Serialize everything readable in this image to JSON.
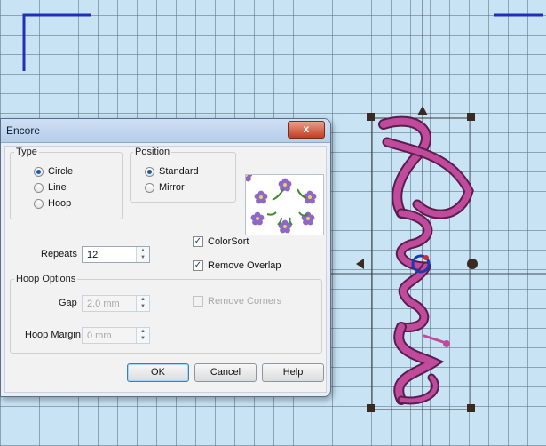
{
  "dialog": {
    "title": "Encore",
    "close_label": "x",
    "type_group": {
      "label": "Type",
      "options": [
        {
          "label": "Circle",
          "selected": true
        },
        {
          "label": "Line",
          "selected": false
        },
        {
          "label": "Hoop",
          "selected": false
        }
      ]
    },
    "position_group": {
      "label": "Position",
      "options": [
        {
          "label": "Standard",
          "selected": true
        },
        {
          "label": "Mirror",
          "selected": false
        }
      ]
    },
    "repeats": {
      "label": "Repeats",
      "value": "12"
    },
    "colorsort": {
      "label": "ColorSort",
      "checked": true
    },
    "remove_overlap": {
      "label": "Remove Overlap",
      "checked": true
    },
    "hoop_options": {
      "label": "Hoop Options",
      "gap": {
        "label": "Gap",
        "value": "2.0 mm"
      },
      "hoop_margin": {
        "label": "Hoop Margin",
        "value": "0 mm"
      },
      "remove_corners": {
        "label": "Remove Corners",
        "checked": false
      }
    },
    "buttons": {
      "ok": "OK",
      "cancel": "Cancel",
      "help": "Help"
    }
  },
  "colors": {
    "grid_bg": "#c8e4f4",
    "hoop_marker": "#1f2fb8",
    "stitch": "#c04a9b",
    "stitch_dark": "#5a1d4c",
    "flower_petal": "#8d67c9",
    "flower_leaf": "#3d8c2e"
  }
}
